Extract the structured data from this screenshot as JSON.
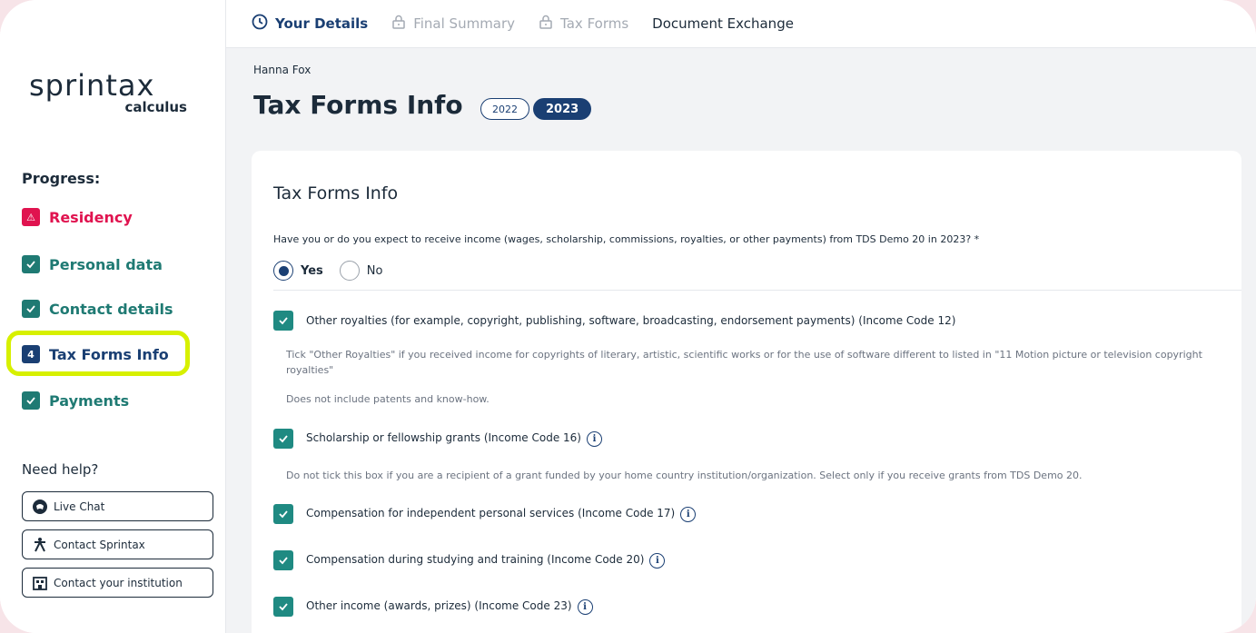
{
  "brand": {
    "logo_main": "sprintax",
    "logo_sub": "calculus"
  },
  "sidebar": {
    "progress_title": "Progress:",
    "steps": [
      {
        "label": "Residency",
        "status": "warning"
      },
      {
        "label": "Personal data",
        "status": "done"
      },
      {
        "label": "Contact details",
        "status": "done"
      },
      {
        "label": "Tax Forms Info",
        "status": "current",
        "number": "4"
      },
      {
        "label": "Payments",
        "status": "done"
      }
    ],
    "help_title": "Need help?",
    "help_buttons": [
      "Live Chat",
      "Contact Sprintax",
      "Contact your institution"
    ]
  },
  "topnav": {
    "items": [
      "Your Details",
      "Final Summary",
      "Tax Forms",
      "Document Exchange"
    ]
  },
  "main": {
    "user_name": "Hanna Fox",
    "page_title": "Tax Forms Info",
    "years": [
      "2022",
      "2023"
    ],
    "selected_year": "2023"
  },
  "card": {
    "title": "Tax Forms Info",
    "question": "Have you or do you expect to receive income (wages, scholarship, commissions, royalties, or other payments) from TDS Demo 20 in 2023? *",
    "answer_yes": "Yes",
    "answer_no": "No",
    "selected_answer": "Yes",
    "options": [
      {
        "label": "Other royalties (for example, copyright, publishing, software, broadcasting, endorsement payments) (Income Code 12)",
        "checked": true
      },
      {
        "label": "Scholarship or fellowship grants (Income Code 16)",
        "checked": true
      },
      {
        "label": "Compensation for independent personal services (Income Code 17)",
        "checked": true
      },
      {
        "label": "Compensation during studying and training (Income Code 20)",
        "checked": true
      },
      {
        "label": "Other income (awards, prizes) (Income Code 23)",
        "checked": true
      }
    ],
    "hint_royalties_1": "Tick \"Other Royalties\" if you received income for copyrights of literary, artistic, scientific works or for the use of software different to listed in \"11 Motion picture or television copyright royalties\"",
    "hint_royalties_2": "Does not include patents and know-how.",
    "hint_scholarship": "Do not tick this box if you are a recipient of a grant funded by your home country institution/organization. Select only if you receive grants from TDS Demo 20."
  },
  "colors": {
    "teal": "#1f8a82",
    "navy": "#1a3f73",
    "alert": "#e0134f",
    "highlight": "#d7f000"
  }
}
